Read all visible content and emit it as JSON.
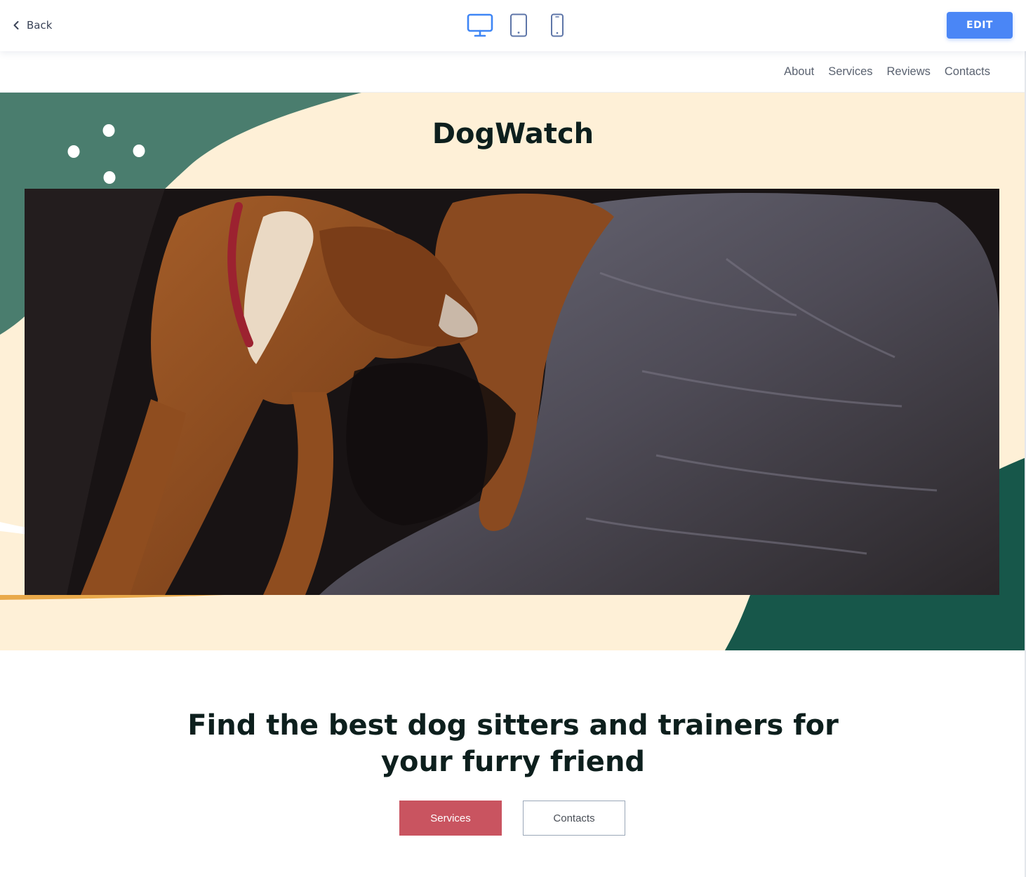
{
  "editor": {
    "back_label": "Back",
    "edit_label": "EDIT",
    "devices": [
      "desktop",
      "tablet",
      "mobile"
    ],
    "active_device": "desktop",
    "accent_color": "#4a86f6"
  },
  "site": {
    "nav": [
      "About",
      "Services",
      "Reviews",
      "Contacts"
    ],
    "hero_title": "DogWatch",
    "hero_image": "two-brown-boxer-dogs-lying-on-gray-blanket",
    "headline": "Find the best dog sitters and trainers for your furry friend",
    "buttons": {
      "primary": "Services",
      "secondary": "Contacts"
    },
    "colors": {
      "cream": "#fef0d7",
      "green": "#4a7d6e",
      "dark_green": "#17574a",
      "primary_button": "#c95460",
      "accent_line": "#e9a94a"
    }
  }
}
